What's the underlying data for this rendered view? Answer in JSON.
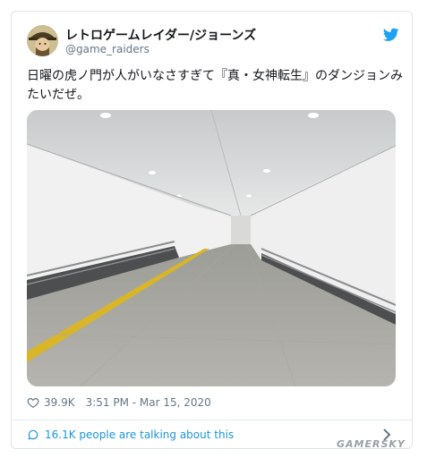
{
  "tweet": {
    "display_name": "レトロゲームレイダー/ジョーンズ",
    "handle": "@game_raiders",
    "text": "日曜の虎ノ門が人がいなさすぎて『真・女神転生』のダンジョンみたいだぜ。",
    "likes": "39.9K",
    "timestamp": "3:51 PM - Mar 15, 2020",
    "talk_text": "16.1K people are talking about this"
  },
  "icons": {
    "avatar": "avatar-illustration",
    "brand": "twitter-bird-icon",
    "like": "heart-icon",
    "talk": "comment-bubble-icon",
    "expand": "chevron-right-icon"
  },
  "colors": {
    "brand_blue": "#1da1f2",
    "link_blue": "#1b95e0",
    "muted_gray": "#657786",
    "border": "#dfe4e8"
  },
  "watermark": "GAMERSKY"
}
